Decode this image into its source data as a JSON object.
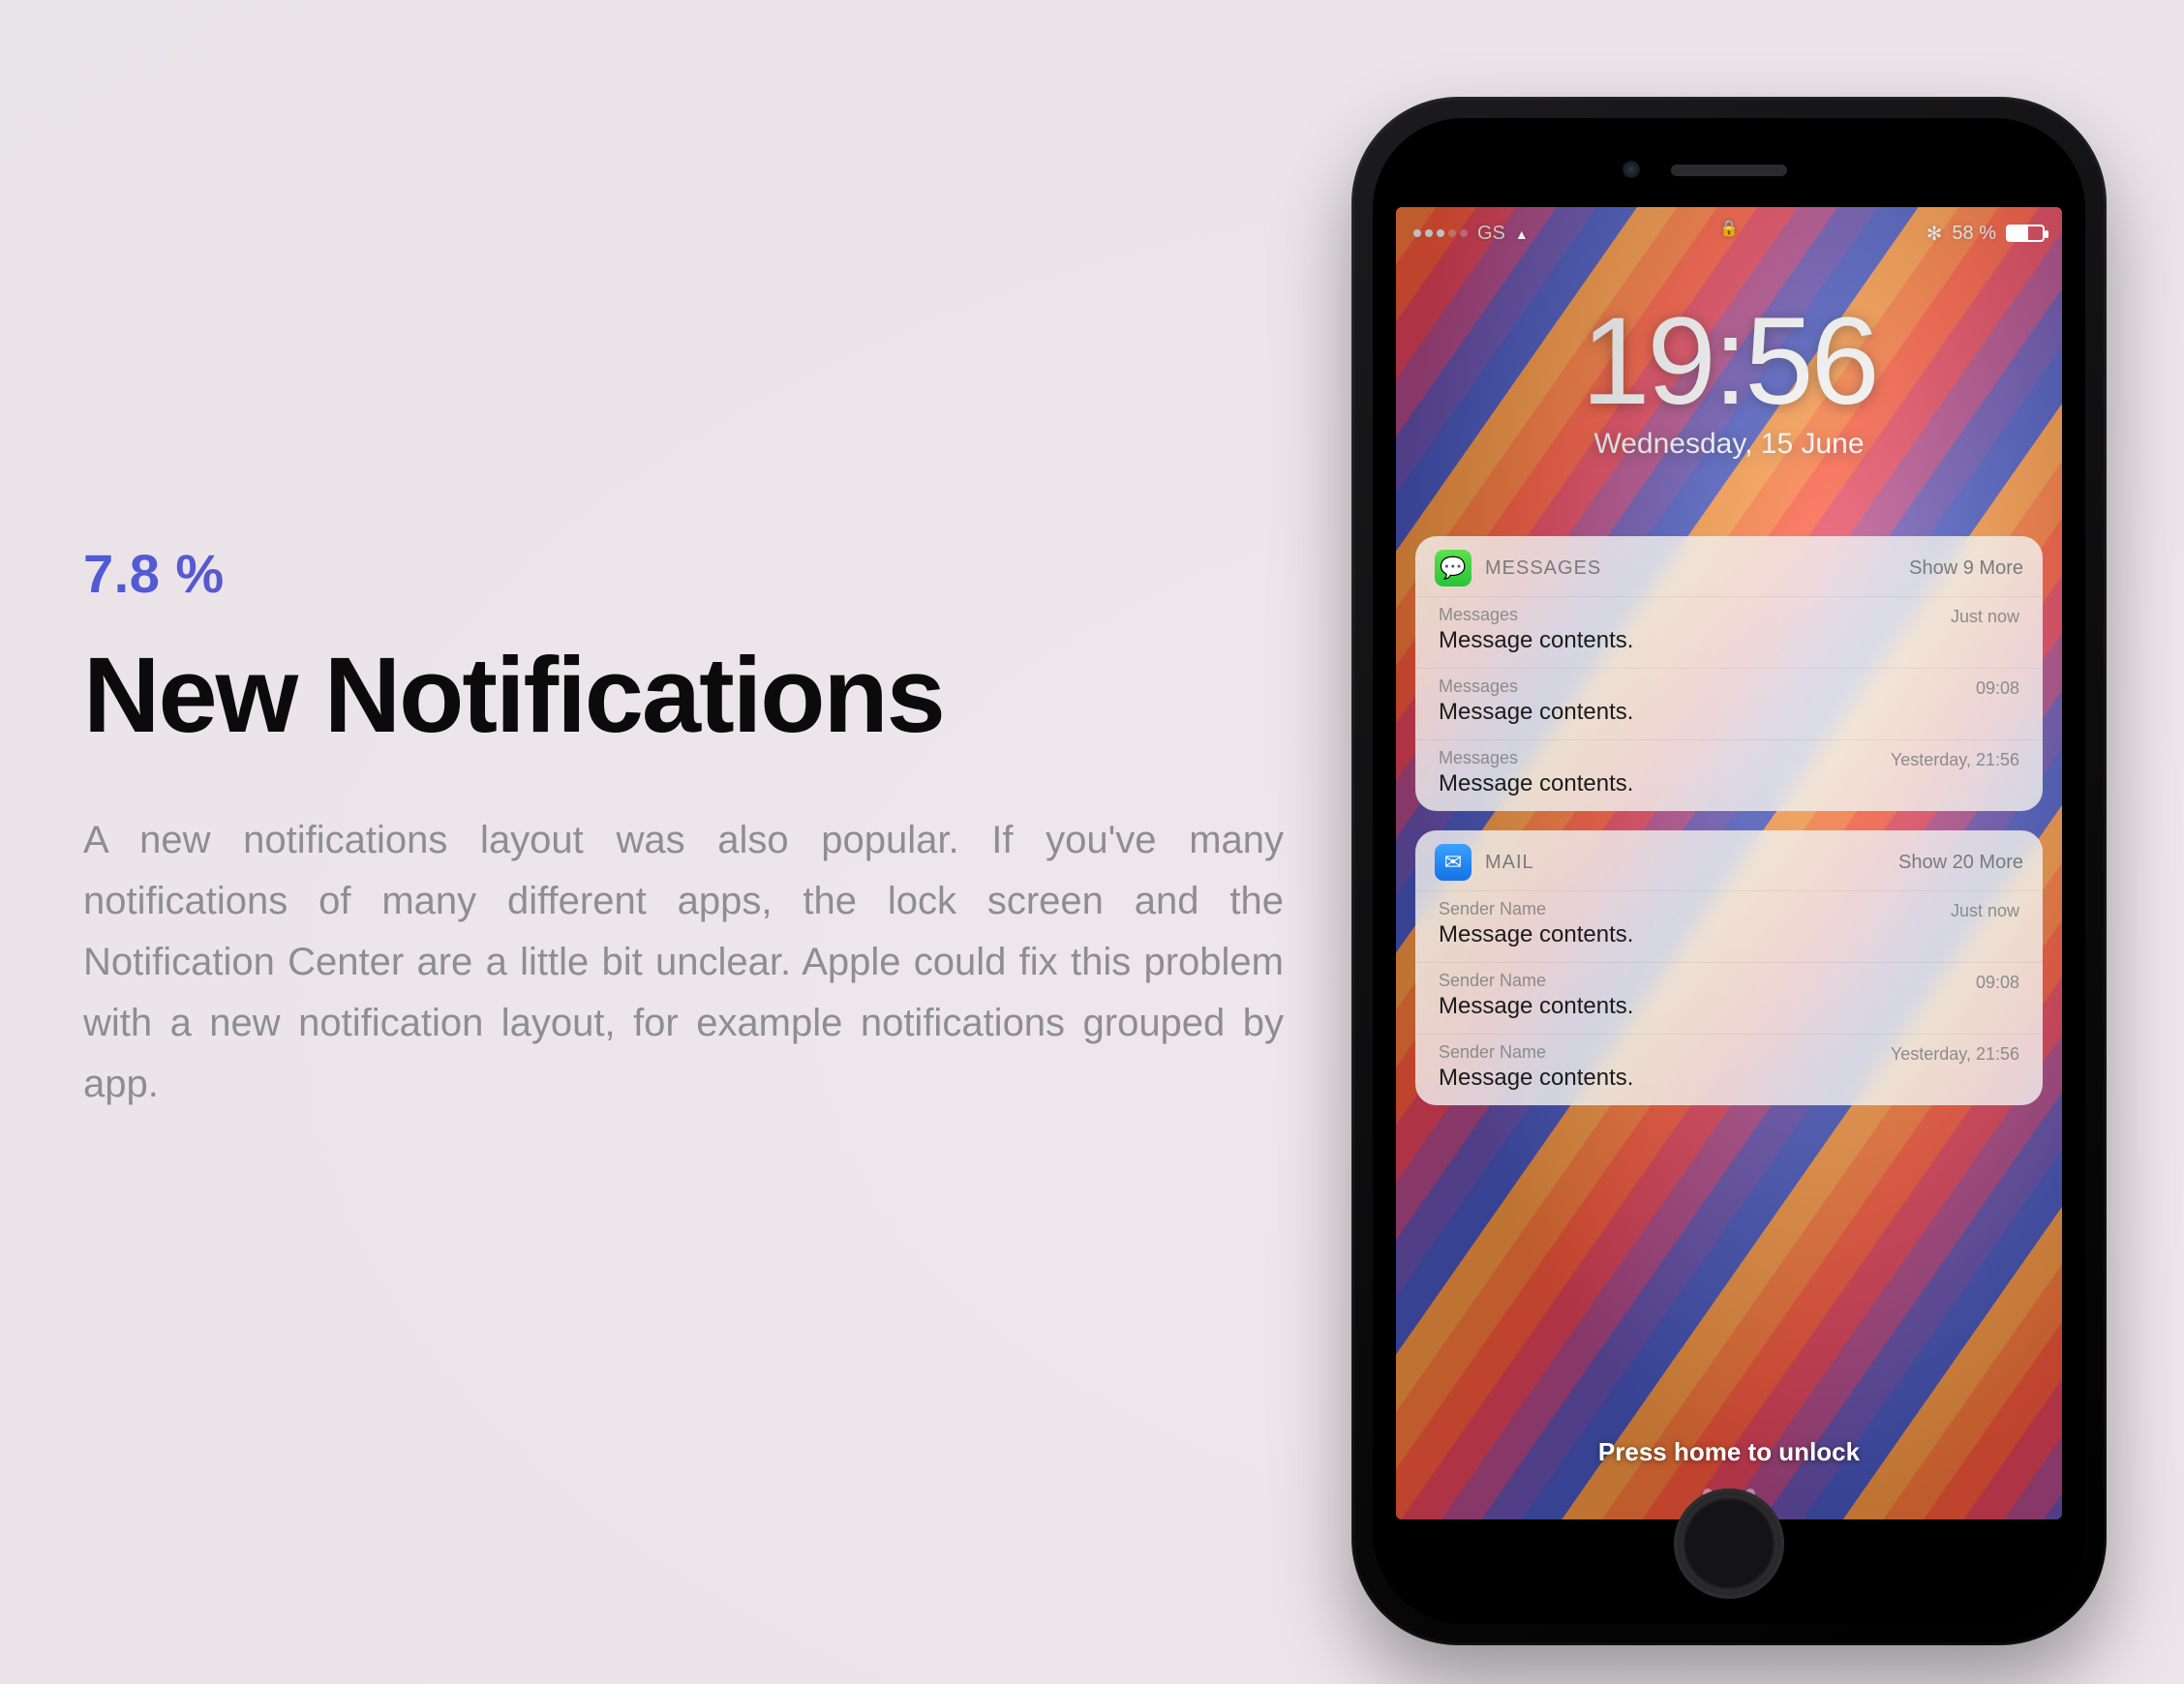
{
  "stat": "7.8 %",
  "headline": "New Notifications",
  "body": "A new notifications layout was also popular. If you've many notifications of many different apps, the lock screen and the Notification Center are a little bit unclear. Apple could fix this problem with a new notification layout, for example notifications grouped by app.",
  "status": {
    "carrier": "GS",
    "battery": "58 %"
  },
  "clock": {
    "time": "19:56",
    "date": "Wednesday, 15 June"
  },
  "groups": [
    {
      "icon": "messages",
      "label": "MESSAGES",
      "more": "Show 9 More",
      "items": [
        {
          "sender": "Messages",
          "body": "Message contents.",
          "ts": "Just now"
        },
        {
          "sender": "Messages",
          "body": "Message contents.",
          "ts": "09:08"
        },
        {
          "sender": "Messages",
          "body": "Message contents.",
          "ts": "Yesterday, 21:56"
        }
      ]
    },
    {
      "icon": "mail",
      "label": "MAIL",
      "more": "Show 20 More",
      "items": [
        {
          "sender": "Sender Name",
          "body": "Message contents.",
          "ts": "Just now"
        },
        {
          "sender": "Sender Name",
          "body": "Message contents.",
          "ts": "09:08"
        },
        {
          "sender": "Sender Name",
          "body": "Message contents.",
          "ts": "Yesterday, 21:56"
        }
      ]
    }
  ],
  "unlock": "Press home to unlock"
}
